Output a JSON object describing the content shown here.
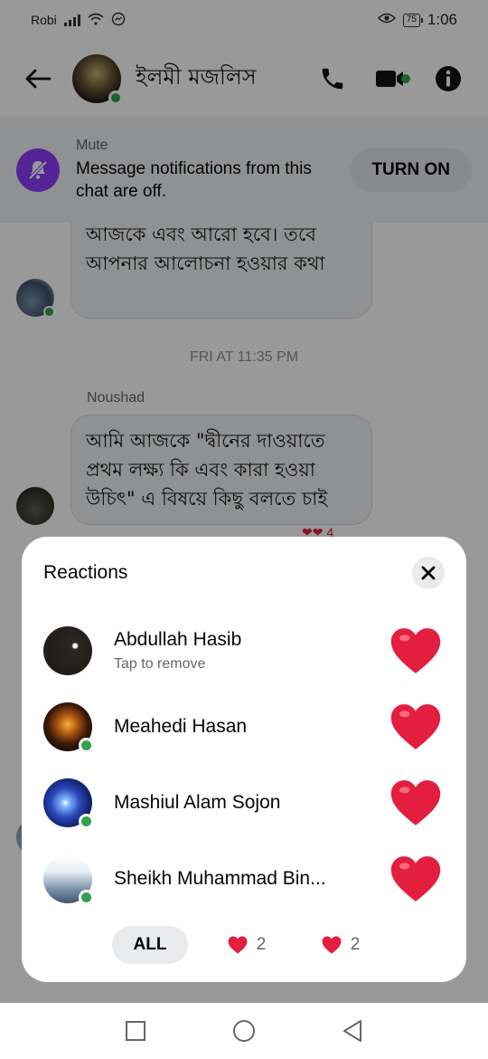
{
  "status_bar": {
    "carrier": "Robi",
    "battery": "75",
    "time": "1:06"
  },
  "header": {
    "chat_title": "ইলমী মজলিস"
  },
  "mute_banner": {
    "title": "Mute",
    "description": "Message notifications from this chat are off.",
    "button_label": "TURN ON"
  },
  "messages": {
    "previous_bubble_text": "আজকে এবং আরো হবে। তবে আপনার আলোচনা হওয়ার কথা",
    "timestamp": "FRI AT 11:35 PM",
    "sender_name": "Noushad",
    "latest_bubble_text": "আমি আজকে \"দ্বীনের দাওয়াতে প্রথম লক্ষ্য কি এবং কারা হওয়া উচিৎ\" এ বিষয়ে কিছু বলতে চাই",
    "reaction_summary": "4"
  },
  "reactions_sheet": {
    "title": "Reactions",
    "reactors": [
      {
        "name": "Abdullah Hasib",
        "subtitle": "Tap to remove",
        "emoji": "heart",
        "online": false
      },
      {
        "name": "Meahedi Hasan",
        "subtitle": "",
        "emoji": "heart",
        "online": true
      },
      {
        "name": "Mashiul Alam Sojon",
        "subtitle": "",
        "emoji": "heart",
        "online": true
      },
      {
        "name": "Sheikh Muhammad Bin...",
        "subtitle": "",
        "emoji": "heart",
        "online": true
      }
    ],
    "tabs": [
      {
        "label": "ALL",
        "selected": true
      },
      {
        "emoji": "heart",
        "count": "2"
      },
      {
        "emoji": "heart",
        "count": "2"
      }
    ]
  },
  "colors": {
    "online_green": "#31a24c",
    "mute_purple": "#8a3ffc",
    "heart_red": "#e41e3f"
  }
}
